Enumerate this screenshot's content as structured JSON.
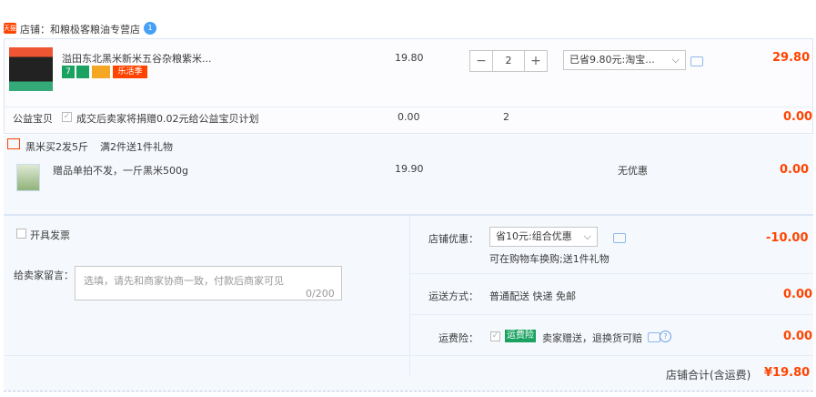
{
  "shop": {
    "badge": "天猫",
    "name": "店铺：和粮极客粮油专营店",
    "ww": "1"
  },
  "item1": {
    "title": "溢田东北黑米新米五谷杂粮紫米...",
    "tags": [
      {
        "text": "7",
        "color": "#1aa260"
      },
      {
        "text": "",
        "color": "#1aa260"
      },
      {
        "text": "",
        "color": "#f5a623"
      },
      {
        "text": "乐活季",
        "color": "#f40"
      }
    ],
    "price": "19.80",
    "qty": "2",
    "promo_select": "已省9.80元:淘宝...",
    "subtotal": "29.80"
  },
  "charity": {
    "label": "公益宝贝",
    "check": "✓",
    "text": "成交后卖家将捐赠0.02元给公益宝贝计划",
    "price": "0.00",
    "qty": "2",
    "subtotal": "0.00"
  },
  "gift": {
    "promo_title": "黑米买2发5斤",
    "promo_rule": "满2件送1件礼物",
    "title": "赠品单拍不发，一斤黑米500g",
    "price": "19.90",
    "discount": "无优惠",
    "subtotal": "0.00"
  },
  "invoice": {
    "label": "开具发票"
  },
  "message": {
    "label": "给卖家留言：",
    "placeholder": "选填，请先和商家协商一致，付款后商家可见",
    "count": "0/200"
  },
  "shop_discount": {
    "label": "店铺优惠：",
    "select": "省10元:组合优惠",
    "note": "可在购物车换购;送1件礼物",
    "amount": "-10.00"
  },
  "shipping": {
    "label": "运送方式：",
    "text": "普通配送 快递 免邮",
    "amount": "0.00"
  },
  "insurance": {
    "label": "运费险：",
    "check": "✓",
    "badge": "运费险",
    "text": "卖家赠送，退换货可赔",
    "amount": "0.00"
  },
  "total": {
    "label": "店铺合计(含运费)",
    "amount": "¥19.80"
  }
}
